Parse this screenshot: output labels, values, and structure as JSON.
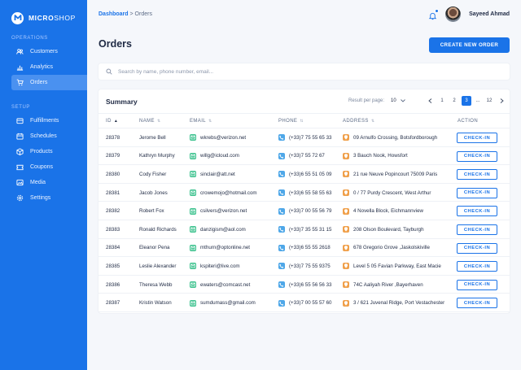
{
  "brand": {
    "name_part1": "MICRO",
    "name_part2": "SHOP"
  },
  "sidebar": {
    "section_operations": "OPERATIONS",
    "section_setup": "SETUP",
    "operations": [
      {
        "label": "Customers",
        "icon": "customers-icon"
      },
      {
        "label": "Analytics",
        "icon": "analytics-icon"
      },
      {
        "label": "Orders",
        "icon": "cart-icon",
        "active": true
      }
    ],
    "setup": [
      {
        "label": "Fulfillments",
        "icon": "fulfillments-icon"
      },
      {
        "label": "Schedules",
        "icon": "calendar-icon"
      },
      {
        "label": "Products",
        "icon": "box-icon"
      },
      {
        "label": "Coupons",
        "icon": "coupon-icon"
      },
      {
        "label": "Media",
        "icon": "media-icon"
      },
      {
        "label": "Settings",
        "icon": "gear-icon"
      }
    ]
  },
  "topbar": {
    "breadcrumb_root": "Dashboard",
    "breadcrumb_sep": " > ",
    "breadcrumb_current": "Orders",
    "user_name": "Sayeed Ahmad"
  },
  "page": {
    "title": "Orders",
    "create_label": "CREATE NEW ORDER",
    "search_placeholder": "Search by name, phone number, email..."
  },
  "summary": {
    "title": "Summary",
    "rpp_label": "Result per page:",
    "rpp_value": "10",
    "pages": [
      "1",
      "2",
      "3",
      "...",
      "12"
    ],
    "active_page": "3"
  },
  "table": {
    "headers": {
      "id": "ID",
      "name": "NAME",
      "email": "EMAIL",
      "phone": "PHONE",
      "address": "ADDRESS",
      "action": "ACTION"
    },
    "action_label": "CHECK-IN",
    "rows": [
      {
        "id": "28378",
        "name": "Jerome Bell",
        "email": "wkrebs@verizon.net",
        "phone": "(+33)7 75 55 65 33",
        "address": "09 Arnulfo Crossing, Botsfordborough"
      },
      {
        "id": "28379",
        "name": "Kathryn Murphy",
        "email": "willg@icloud.com",
        "phone": "(+33)7 55 72 67",
        "address": "3 Bauch Nook, Howsfort"
      },
      {
        "id": "28380",
        "name": "Cody Fisher",
        "email": "sinclair@att.net",
        "phone": "(+33)6 55 51 05 09",
        "address": "21 rue Neuve Popincourt 75009 Paris"
      },
      {
        "id": "28381",
        "name": "Jacob Jones",
        "email": "crowemojo@hotmail.com",
        "phone": "(+33)6 55 58 55 63",
        "address": "0 / 77 Purdy Crescent, West Arthur"
      },
      {
        "id": "28382",
        "name": "Robert Fox",
        "email": "csilvers@verizon.net",
        "phone": "(+33)7 00 55 56 79",
        "address": "4 Novella Block, Eichmannview"
      },
      {
        "id": "28383",
        "name": "Ronald Richards",
        "email": "danzigism@aol.com",
        "phone": "(+33)7 35 55 31 15",
        "address": "208 Olson Boulevard, Tayburgh"
      },
      {
        "id": "28384",
        "name": "Eleanor Pena",
        "email": "mthurn@optonline.net",
        "phone": "(+33)6 55 55 2618",
        "address": "678 Gregorio Grove ,Jaskolskiville"
      },
      {
        "id": "28385",
        "name": "Leslie Alexander",
        "email": "kspiteri@live.com",
        "phone": "(+33)7 75 55 9375",
        "address": "Level 5 05 Favian Parkway, East Macie"
      },
      {
        "id": "28386",
        "name": "Theresa Webb",
        "email": "ewaters@comcast.net",
        "phone": "(+33)6 55 56 56 33",
        "address": "74C Aaliyah River ,Bayerhaven"
      },
      {
        "id": "28387",
        "name": "Kristin Watson",
        "email": "sumdumass@gmail.com",
        "phone": "(+33)7 00 55 57 60",
        "address": "3 / 621 Juvenal Ridge, Port Vestachester"
      }
    ]
  },
  "colors": {
    "primary": "#1a73e8",
    "email_icon": "#3ec28f",
    "phone_icon": "#4ea7e8",
    "address_icon": "#f0a04b"
  }
}
